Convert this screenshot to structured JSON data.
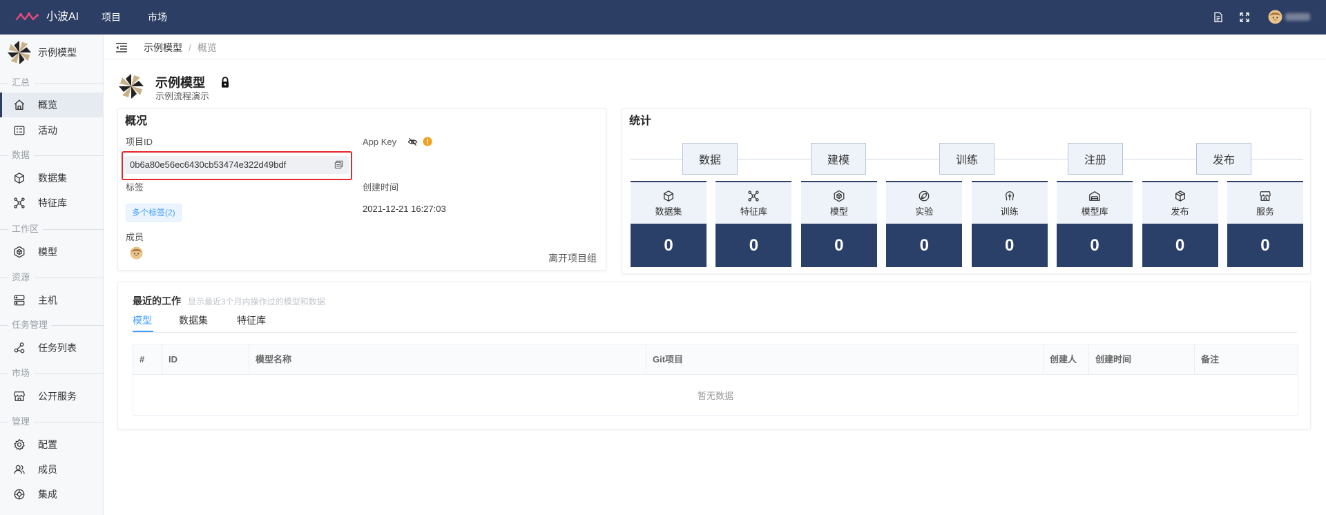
{
  "app": {
    "name": "小波AI",
    "logo_icon": "wave-logo-icon",
    "nav": [
      {
        "label": "项目"
      },
      {
        "label": "市场"
      }
    ],
    "header_icons": [
      "document-icon",
      "fullscreen-icon",
      "user-avatar"
    ],
    "colors": {
      "topbar": "#2c3e64",
      "accent": "#409eff",
      "stat_dark": "#2b4068",
      "highlight_border": "#e6262a",
      "logo": "#e84a7f"
    }
  },
  "sidebar": {
    "project": {
      "name": "示例模型",
      "icon": "project-pinwheel-icon"
    },
    "sections": [
      {
        "label": "汇总",
        "items": [
          {
            "label": "概览",
            "icon": "home-icon",
            "active": true
          },
          {
            "label": "活动",
            "icon": "activity-icon"
          }
        ]
      },
      {
        "label": "数据",
        "items": [
          {
            "label": "数据集",
            "icon": "cube-icon"
          },
          {
            "label": "特征库",
            "icon": "feature-nodes-icon"
          }
        ]
      },
      {
        "label": "工作区",
        "items": [
          {
            "label": "模型",
            "icon": "model-icon"
          }
        ]
      },
      {
        "label": "资源",
        "items": [
          {
            "label": "主机",
            "icon": "server-icon"
          }
        ]
      },
      {
        "label": "任务管理",
        "items": [
          {
            "label": "任务列表",
            "icon": "share-nodes-icon"
          }
        ]
      },
      {
        "label": "市场",
        "items": [
          {
            "label": "公开服务",
            "icon": "store-icon"
          }
        ]
      },
      {
        "label": "管理",
        "items": [
          {
            "label": "配置",
            "icon": "gear-icon"
          },
          {
            "label": "成员",
            "icon": "users-icon"
          },
          {
            "label": "集成",
            "icon": "integration-icon"
          }
        ]
      }
    ]
  },
  "breadcrumb": {
    "items": [
      "示例模型",
      "概览"
    ],
    "separator": "/"
  },
  "project": {
    "title": "示例模型",
    "subtitle": "示例流程演示",
    "locked": true
  },
  "overview": {
    "title": "概况",
    "project_id_label": "项目ID",
    "project_id": "0b6a80e56ec6430cb53474e322d49bdf",
    "app_key_label": "App Key",
    "tags_label": "标签",
    "tags_value": "多个标签(2)",
    "created_label": "创建时间",
    "created_value": "2021-12-21 16:27:03",
    "members_label": "成员",
    "leave_label": "离开项目组"
  },
  "stats": {
    "title": "统计",
    "stages": [
      "数据",
      "建模",
      "训练",
      "注册",
      "发布"
    ],
    "cards": [
      {
        "label": "数据集",
        "icon": "cube-icon",
        "value": 0
      },
      {
        "label": "特征库",
        "icon": "feature-nodes-icon",
        "value": 0
      },
      {
        "label": "模型",
        "icon": "model-icon",
        "value": 0
      },
      {
        "label": "实验",
        "icon": "flask-icon",
        "value": 0
      },
      {
        "label": "训练",
        "icon": "brain-icon",
        "value": 0
      },
      {
        "label": "模型库",
        "icon": "warehouse-icon",
        "value": 0
      },
      {
        "label": "发布",
        "icon": "box-icon",
        "value": 0
      },
      {
        "label": "服务",
        "icon": "store-icon",
        "value": 0
      }
    ]
  },
  "recent": {
    "title": "最近的工作",
    "hint": "显示最近3个月内操作过的模型和数据",
    "tabs": [
      "模型",
      "数据集",
      "特征库"
    ],
    "active_tab": "模型",
    "columns": [
      "#",
      "ID",
      "模型名称",
      "Git项目",
      "创建人",
      "创建时间",
      "备注"
    ],
    "empty_text": "暂无数据"
  }
}
